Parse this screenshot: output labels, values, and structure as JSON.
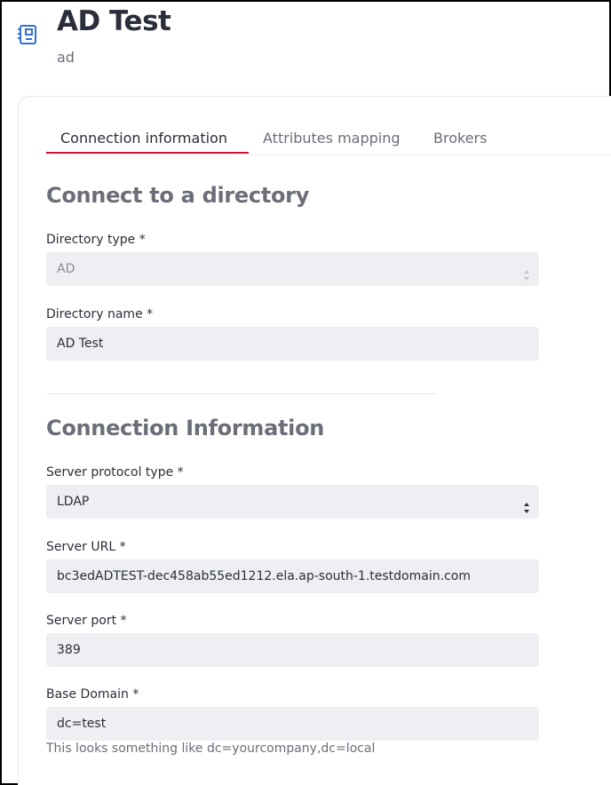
{
  "header": {
    "title": "AD Test",
    "subtitle": "ad",
    "icon": "directory-book-icon"
  },
  "tabs": [
    {
      "label": "Connection information",
      "active": true
    },
    {
      "label": "Attributes mapping",
      "active": false
    },
    {
      "label": "Brokers",
      "active": false
    }
  ],
  "sections": {
    "connect": {
      "title": "Connect to a directory"
    },
    "connection": {
      "title": "Connection Information"
    }
  },
  "fields": {
    "directory_type": {
      "label": "Directory type *",
      "value": "AD",
      "disabled": true
    },
    "directory_name": {
      "label": "Directory name *",
      "value": "AD Test"
    },
    "server_protocol": {
      "label": "Server protocol type *",
      "value": "LDAP"
    },
    "server_url": {
      "label": "Server URL *",
      "value": "bc3edADTEST-dec458ab55ed1212.ela.ap-south-1.testdomain.com"
    },
    "server_port": {
      "label": "Server port *",
      "value": "389"
    },
    "base_domain": {
      "label": "Base Domain *",
      "value": "dc=test",
      "hint": "This looks something like dc=yourcompany,dc=local"
    }
  },
  "colors": {
    "accent": "#c8102e",
    "field_bg": "#eeeff2",
    "icon": "#2f6fd6"
  }
}
